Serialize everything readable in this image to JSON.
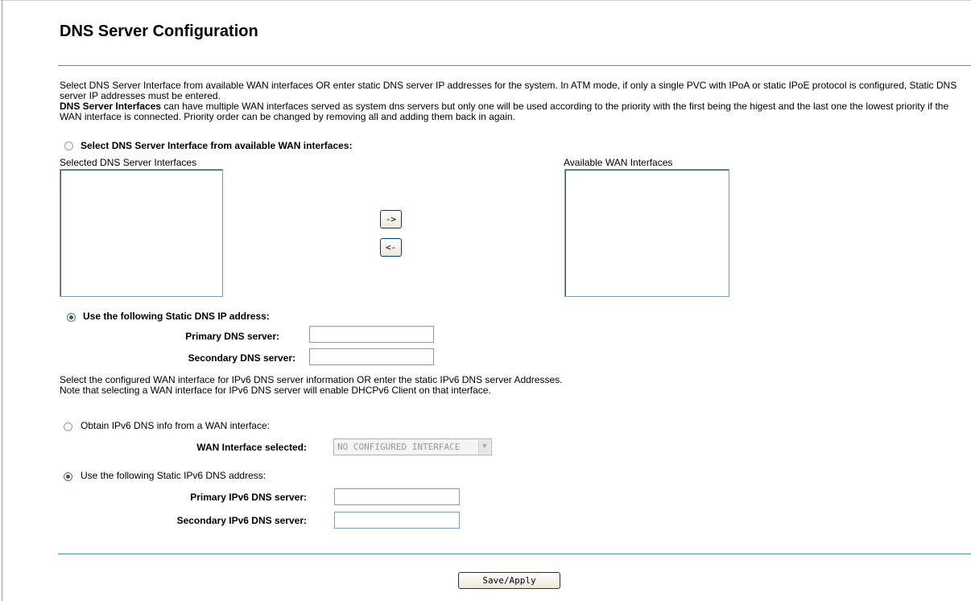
{
  "page": {
    "title": "DNS Server Configuration",
    "description_line1": "Select DNS Server Interface from available WAN interfaces OR enter static DNS server IP addresses for the system. In ATM mode, if only a single PVC with IPoA or static IPoE protocol is configured, Static DNS server IP addresses must be entered.",
    "description_line2_bold": "DNS Server Interfaces",
    "description_line2_rest": " can have multiple WAN interfaces served as system dns servers but only one will be used according to the priority with the first being the higest and the last one the lowest priority if the WAN interface is connected. Priority order can be changed by removing all and adding them back in again."
  },
  "ipv4": {
    "wan_option_label": "Select DNS Server Interface from available WAN interfaces:",
    "selected_list_label": "Selected DNS Server Interfaces",
    "available_list_label": "Available WAN Interfaces",
    "move_right_label": "->",
    "move_left_label": "<-",
    "static_option_label": "Use the following Static DNS IP address:",
    "primary_label": "Primary DNS server:",
    "primary_value": "",
    "secondary_label": "Secondary DNS server:",
    "secondary_value": "",
    "selected_option": "static"
  },
  "ipv6": {
    "note_line1": "Select the configured WAN interface for IPv6 DNS server information OR enter the static IPv6 DNS server Addresses.",
    "note_line2": "Note that selecting a WAN interface for IPv6 DNS server will enable DHCPv6 Client on that interface.",
    "wan_option_label": "Obtain IPv6 DNS info from a WAN interface:",
    "wan_interface_label": "WAN Interface selected:",
    "wan_interface_value": "NO CONFIGURED INTERFACE",
    "static_option_label": "Use the following Static IPv6 DNS address:",
    "primary_label": "Primary IPv6 DNS server:",
    "primary_value": "",
    "secondary_label": "Secondary IPv6 DNS server:",
    "secondary_value": "",
    "selected_option": "static"
  },
  "footer": {
    "save_label": "Save/Apply"
  },
  "colors": {
    "divider": "#4a90b8",
    "radio_dot": "#2a6a2a"
  }
}
